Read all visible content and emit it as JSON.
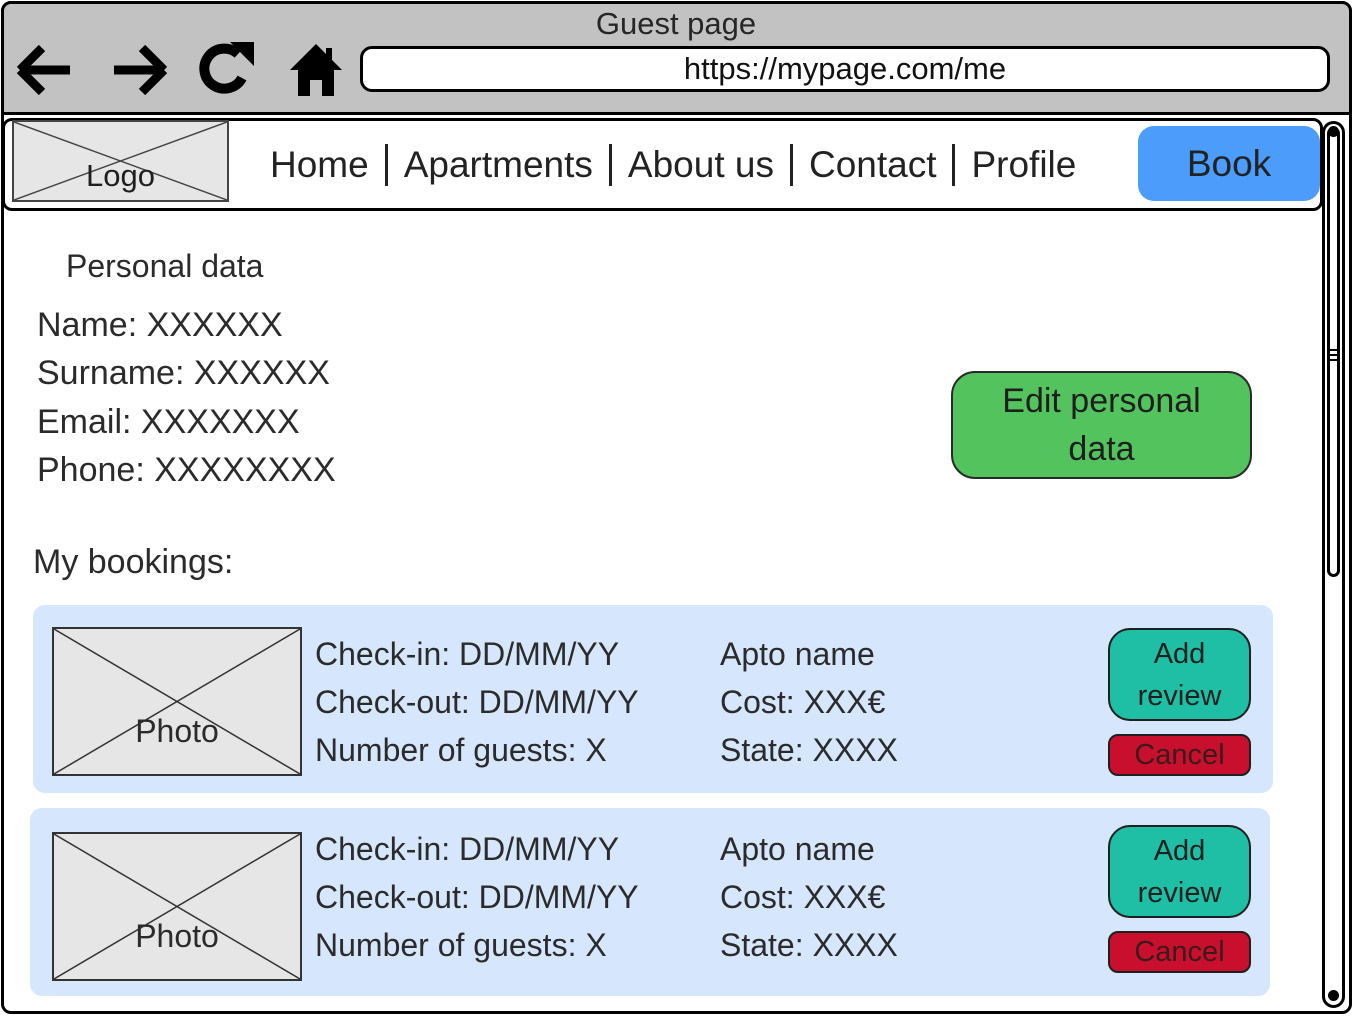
{
  "browser": {
    "title": "Guest page",
    "url": "https://mypage.com/me",
    "icons": [
      "back-arrow-icon",
      "forward-arrow-icon",
      "reload-icon",
      "home-icon"
    ]
  },
  "header": {
    "logo_text": "Logo",
    "nav": [
      "Home",
      "Apartments",
      "About us",
      "Contact",
      "Profile"
    ],
    "book_label": "Book"
  },
  "personal": {
    "title": "Personal data",
    "name": "Name: XXXXXX",
    "surname": "Surname: XXXXXX",
    "email": "Email: XXXXXXX",
    "phone": "Phone: XXXXXXXX",
    "edit_label": "Edit personal data"
  },
  "bookings": {
    "title": "My bookings:",
    "items": [
      {
        "photo_label": "Photo",
        "checkin": "Check-in: DD/MM/YY",
        "checkout": "Check-out: DD/MM/YY",
        "guests": "Number of guests: X",
        "apto": "Apto name",
        "cost": "Cost: XXX€",
        "state": "State: XXXX",
        "review_label": "Add review",
        "cancel_label": "Cancel"
      },
      {
        "photo_label": "Photo",
        "checkin": "Check-in: DD/MM/YY",
        "checkout": "Check-out: DD/MM/YY",
        "guests": "Number of guests: X",
        "apto": "Apto name",
        "cost": "Cost: XXX€",
        "state": "State: XXXX",
        "review_label": "Add review",
        "cancel_label": "Cancel"
      }
    ]
  },
  "colors": {
    "chrome": "#c2c2c2",
    "book_button": "#4c9cfc",
    "edit_button": "#53c45d",
    "card_bg": "#d6e7fd",
    "review_button": "#1ebfa4",
    "cancel_button": "#c8102e"
  }
}
